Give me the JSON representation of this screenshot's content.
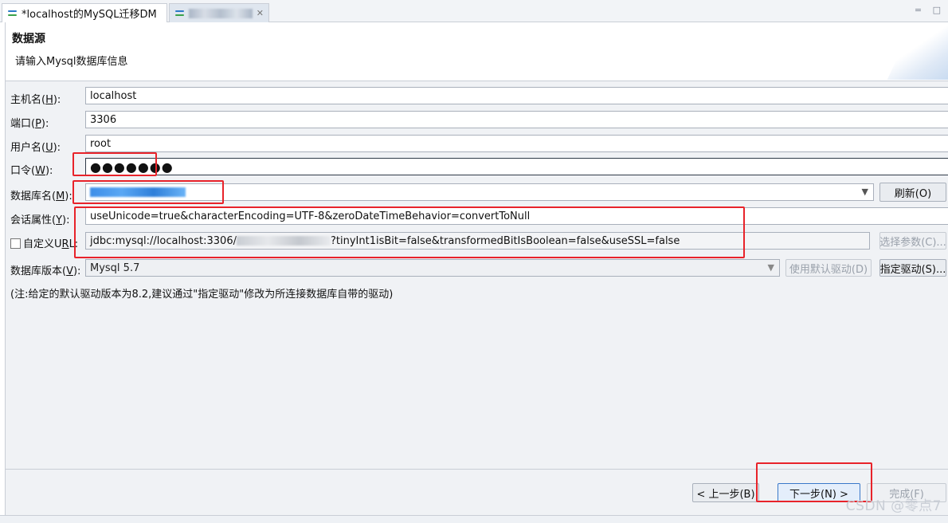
{
  "tabs": [
    {
      "label": "*localhost的MySQL迁移DM"
    }
  ],
  "window_controls": "= □",
  "header": {
    "title": "数据源",
    "description": "请输入Mysql数据库信息"
  },
  "form": {
    "host": {
      "label": "主机名(",
      "key": "H",
      "suffix": "):",
      "value": "localhost"
    },
    "port": {
      "label": "端口(",
      "key": "P",
      "suffix": "):",
      "value": "3306"
    },
    "user": {
      "label": "用户名(",
      "key": "U",
      "suffix": "):",
      "value": "root"
    },
    "password": {
      "label": "口令(",
      "key": "W",
      "suffix": "):",
      "value": "●●●●●●●"
    },
    "database": {
      "label": "数据库名(",
      "key": "M",
      "suffix": "):",
      "value": "",
      "refresh_label": "刷新(O)"
    },
    "session": {
      "label": "会话属性(",
      "key": "Y",
      "suffix": "):",
      "value": "useUnicode=true&characterEncoding=UTF-8&zeroDateTimeBehavior=convertToNull"
    },
    "custom_url": {
      "label": "自定义U",
      "key": "R",
      "suffix": "L:",
      "value_start": "jdbc:mysql://localhost:3306/",
      "value_end": "?tinyInt1isBit=false&transformedBitIsBoolean=false&useSSL=false",
      "select_params_label": "选择参数(C)..."
    },
    "db_version": {
      "label": "数据库版本(",
      "key": "V",
      "suffix": "):",
      "value": "Mysql 5.7",
      "default_driver_label": "使用默认驱动(D)",
      "specify_driver_label": "指定驱动(S)..."
    },
    "note": "(注:给定的默认驱动版本为8.2,建议通过\"指定驱动\"修改为所连接数据库自带的驱动)"
  },
  "buttons": {
    "back": "< 上一步(B)",
    "next": "下一步(N) >",
    "finish": "完成(F)"
  },
  "watermark": "CSDN @零点7",
  "colors": {
    "highlight": "#e8232a",
    "tab_icon": "#2a79c9"
  }
}
